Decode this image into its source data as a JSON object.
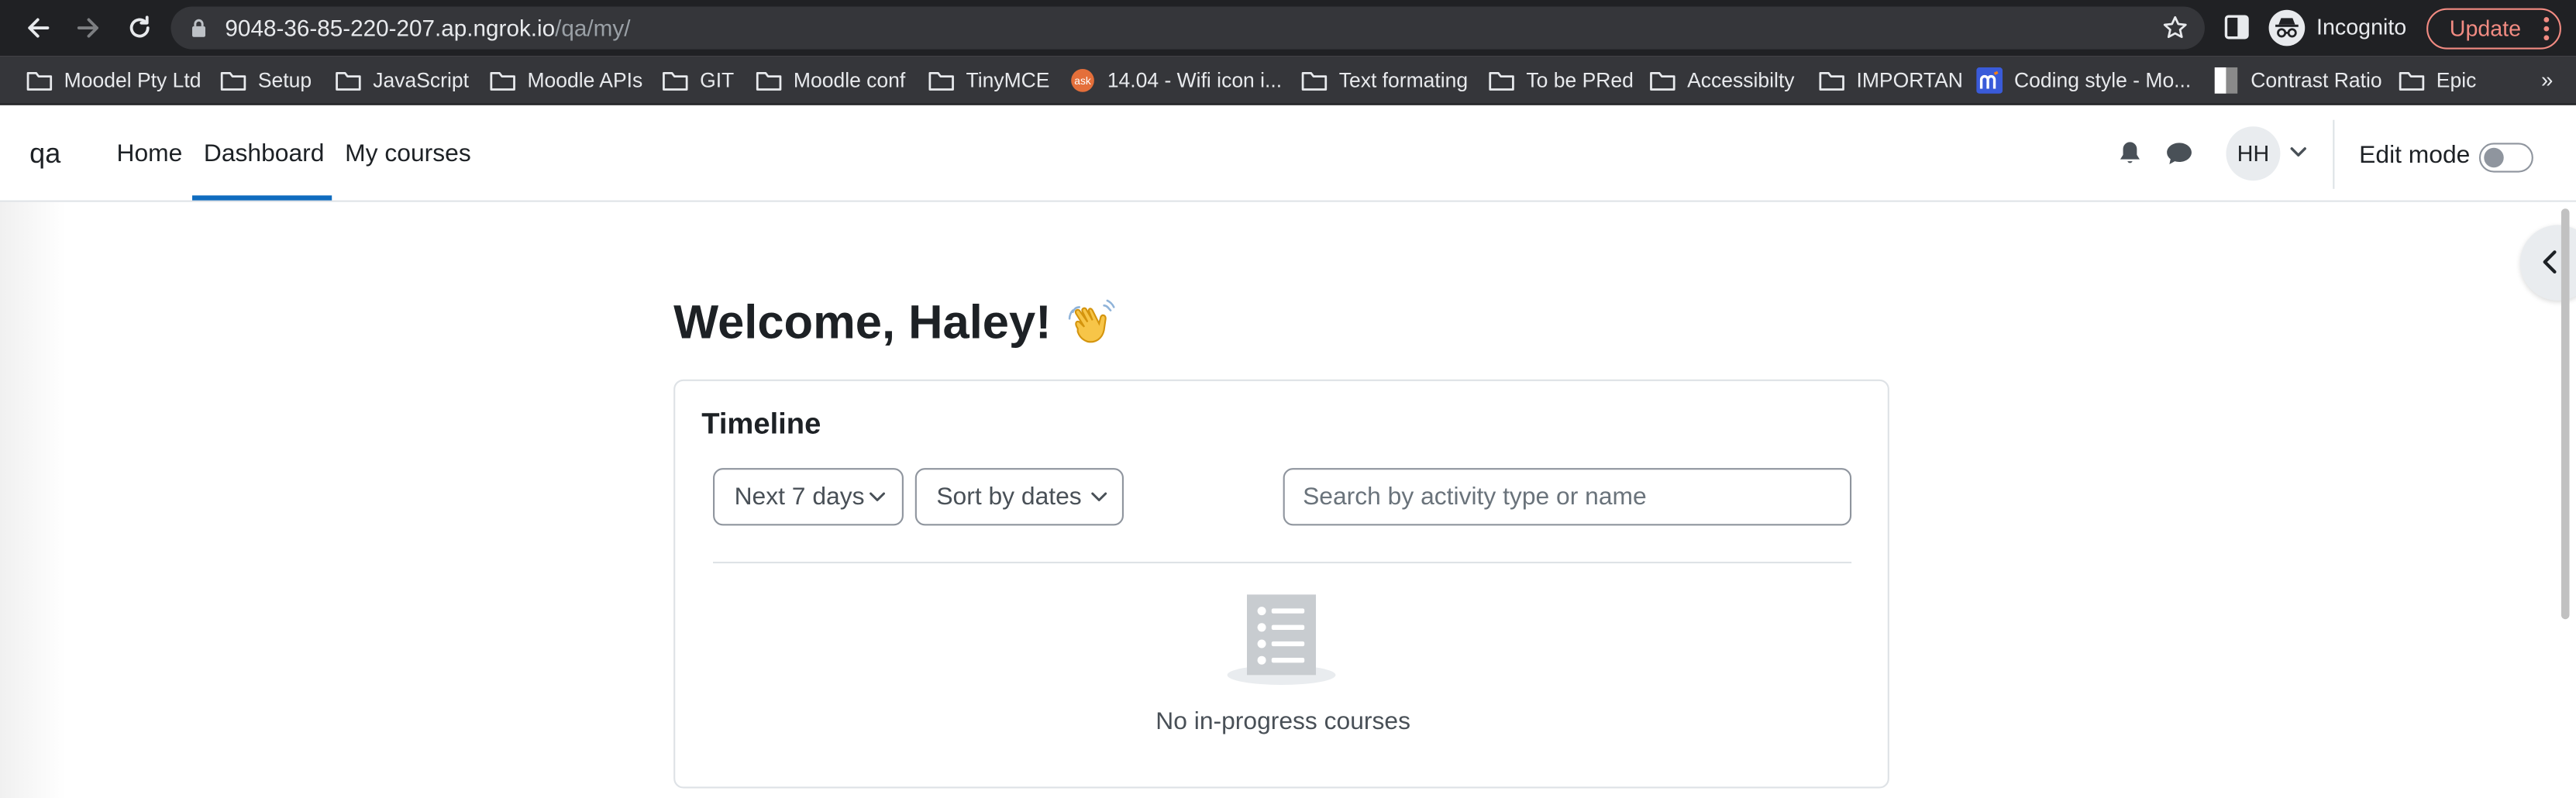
{
  "browser": {
    "url_host": "9048-36-85-220-207.ap.ngrok.io",
    "url_path": "/qa/my/",
    "incognito_label": "Incognito",
    "update_label": "Update",
    "bookmarks": [
      {
        "label": "Moodel Pty Ltd",
        "icon": "folder-icon"
      },
      {
        "label": "Setup",
        "icon": "folder-icon"
      },
      {
        "label": "JavaScript",
        "icon": "folder-icon"
      },
      {
        "label": "Moodle APIs",
        "icon": "folder-icon"
      },
      {
        "label": "GIT",
        "icon": "folder-icon"
      },
      {
        "label": "Moodle conf",
        "icon": "folder-icon"
      },
      {
        "label": "TinyMCE",
        "icon": "folder-icon"
      },
      {
        "label": "14.04 - Wifi icon i...",
        "icon": "askubuntu-icon"
      },
      {
        "label": "Text formating",
        "icon": "folder-icon"
      },
      {
        "label": "To be PRed",
        "icon": "folder-icon"
      },
      {
        "label": "Accessibilty",
        "icon": "folder-icon"
      },
      {
        "label": "IMPORTAN",
        "icon": "folder-icon"
      },
      {
        "label": "Coding style - Mo...",
        "icon": "moodle-icon"
      },
      {
        "label": "Contrast Ratio",
        "icon": "contrast-icon"
      },
      {
        "label": "Epic",
        "icon": "folder-icon"
      }
    ],
    "more_label": "»"
  },
  "moodle": {
    "brand": "qa",
    "nav": {
      "home": "Home",
      "dashboard": "Dashboard",
      "my_courses": "My courses"
    },
    "user_initials": "HH",
    "edit_mode_label": "Edit mode",
    "edit_mode_on": false
  },
  "main": {
    "welcome": "Welcome, Haley!",
    "timeline": {
      "title": "Timeline",
      "filter_label": "Next 7 days",
      "sort_label": "Sort by dates",
      "search_placeholder": "Search by activity type or name",
      "empty_text": "No in-progress courses"
    }
  },
  "colors": {
    "accent": "#0f6cbf",
    "chrome_dark": "#202124",
    "chrome_bar": "#35363a",
    "update_red": "#f28b82"
  }
}
